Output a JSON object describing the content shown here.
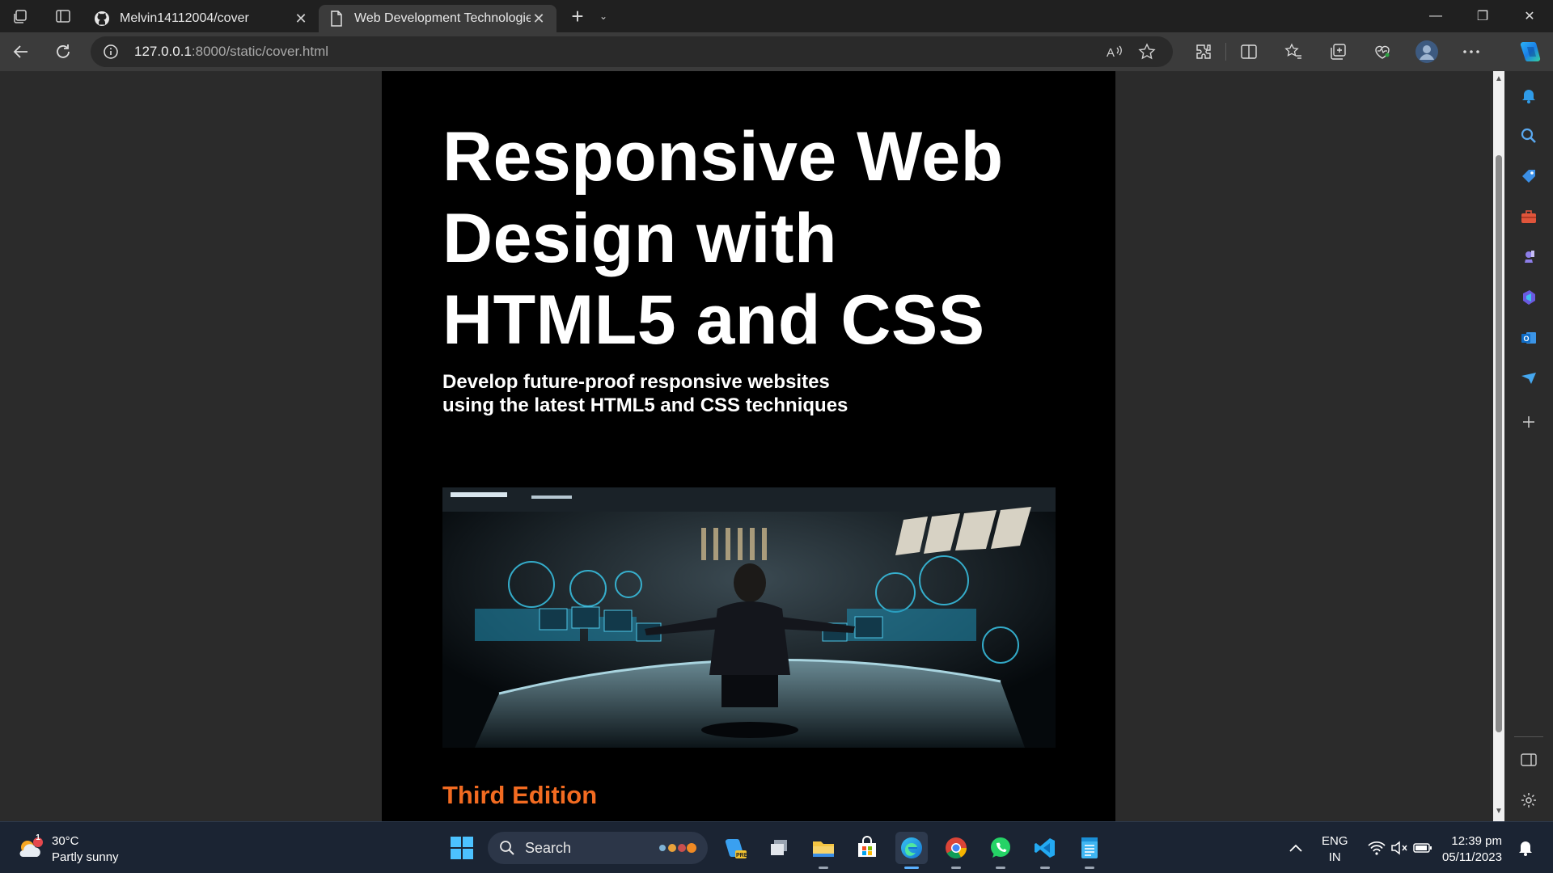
{
  "browser": {
    "tabs": [
      {
        "title": "Melvin14112004/cover",
        "favicon": "github-icon"
      },
      {
        "title": "Web Development Technologies",
        "favicon": "page-icon"
      }
    ],
    "url_host": "127.0.0.1",
    "url_path": ":8000/static/cover.html"
  },
  "cover": {
    "title": "Responsive Web Design with HTML5 and CSS",
    "subtitle_line1": "Develop future-proof responsive websites",
    "subtitle_line2": "using the latest HTML5 and CSS techniques",
    "edition": "Third Edition",
    "edition_color": "#f26b21"
  },
  "taskbar": {
    "weather_temp": "30°C",
    "weather_desc": "Partly sunny",
    "weather_badge": "1",
    "search_label": "Search",
    "lang_1": "ENG",
    "lang_2": "IN",
    "time": "12:39 pm",
    "date": "05/11/2023"
  },
  "colors": {
    "tab_bar": "#202020",
    "toolbar": "#3b3b3b",
    "page_bg": "#2b2b2b",
    "taskbar": "#1b2433"
  }
}
